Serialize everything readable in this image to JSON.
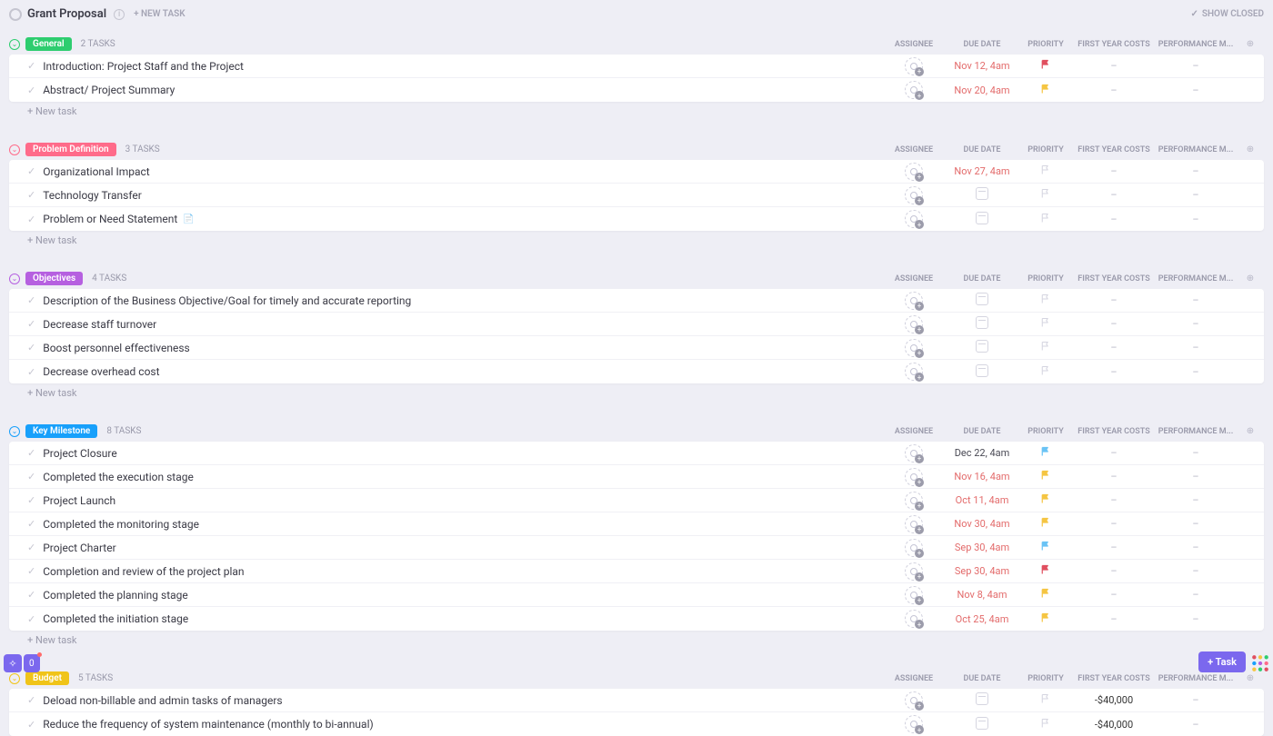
{
  "header": {
    "title": "Grant Proposal",
    "new_task": "+ NEW TASK",
    "show_closed": "SHOW CLOSED"
  },
  "columns": {
    "assignee": "ASSIGNEE",
    "due_date": "DUE DATE",
    "priority": "PRIORITY",
    "first_year": "FIRST YEAR COSTS",
    "perf": "PERFORMANCE M..."
  },
  "colors": {
    "general": "#2ecd6f",
    "problem": "#ff6b8a",
    "objectives": "#b660e0",
    "milestone": "#18a0fb",
    "budget": "#f0c419",
    "flag_red": "#e04f5f",
    "flag_yellow": "#f5c542",
    "flag_blue": "#6ac3f5",
    "flag_grey": "#d5d5e0"
  },
  "add_task": "+ New task",
  "plus": "+",
  "fab": "+  Task",
  "statuses": [
    {
      "name": "General",
      "color_key": "general",
      "count": "2 TASKS",
      "tasks": [
        {
          "name": "Introduction: Project Staff and the Project",
          "due": "Nov 12, 4am",
          "due_red": true,
          "flag": "red",
          "first": "–",
          "perf": "–"
        },
        {
          "name": "Abstract/ Project Summary",
          "due": "Nov 20, 4am",
          "due_red": true,
          "flag": "yellow",
          "first": "–",
          "perf": "–"
        }
      ],
      "show_add": true
    },
    {
      "name": "Problem Definition",
      "color_key": "problem",
      "count": "3 TASKS",
      "tasks": [
        {
          "name": "Organizational Impact",
          "due": "Nov 27, 4am",
          "due_red": true,
          "flag": "grey",
          "first": "–",
          "perf": "–"
        },
        {
          "name": "Technology Transfer",
          "due": "",
          "flag": "grey",
          "first": "–",
          "perf": "–"
        },
        {
          "name": "Problem or Need Statement",
          "doc": true,
          "due": "",
          "flag": "grey",
          "first": "–",
          "perf": "–"
        }
      ],
      "show_add": true
    },
    {
      "name": "Objectives",
      "color_key": "objectives",
      "count": "4 TASKS",
      "tasks": [
        {
          "name": "Description of the Business Objective/Goal for timely and accurate reporting",
          "due": "",
          "flag": "grey",
          "first": "–",
          "perf": "–"
        },
        {
          "name": "Decrease staff turnover",
          "due": "",
          "flag": "grey",
          "first": "–",
          "perf": "–"
        },
        {
          "name": "Boost personnel effectiveness",
          "due": "",
          "flag": "grey",
          "first": "–",
          "perf": "–"
        },
        {
          "name": "Decrease overhead cost",
          "due": "",
          "flag": "grey",
          "first": "–",
          "perf": "–"
        }
      ],
      "show_add": true
    },
    {
      "name": "Key Milestone",
      "color_key": "milestone",
      "count": "8 TASKS",
      "tasks": [
        {
          "name": "Project Closure",
          "due": "Dec 22, 4am",
          "due_red": false,
          "flag": "blue",
          "first": "–",
          "perf": "–"
        },
        {
          "name": "Completed the execution stage",
          "due": "Nov 16, 4am",
          "due_red": true,
          "flag": "yellow",
          "first": "–",
          "perf": "–"
        },
        {
          "name": "Project Launch",
          "due": "Oct 11, 4am",
          "due_red": true,
          "flag": "yellow",
          "first": "–",
          "perf": "–"
        },
        {
          "name": "Completed the monitoring stage",
          "due": "Nov 30, 4am",
          "due_red": true,
          "flag": "yellow",
          "first": "–",
          "perf": "–"
        },
        {
          "name": "Project Charter",
          "due": "Sep 30, 4am",
          "due_red": true,
          "flag": "blue",
          "first": "–",
          "perf": "–"
        },
        {
          "name": "Completion and review of the project plan",
          "due": "Sep 30, 4am",
          "due_red": true,
          "flag": "red",
          "first": "–",
          "perf": "–"
        },
        {
          "name": "Completed the planning stage",
          "due": "Nov 8, 4am",
          "due_red": true,
          "flag": "yellow",
          "first": "–",
          "perf": "–"
        },
        {
          "name": "Completed the initiation stage",
          "due": "Oct 25, 4am",
          "due_red": true,
          "flag": "yellow",
          "first": "–",
          "perf": "–"
        }
      ],
      "show_add": true
    },
    {
      "name": "Budget",
      "color_key": "budget",
      "count": "5 TASKS",
      "tasks": [
        {
          "name": "Deload non-billable and admin tasks of managers",
          "due": "",
          "flag": "grey",
          "first": "-$40,000",
          "perf": "–"
        },
        {
          "name": "Reduce the frequency of system maintenance (monthly to bi-annual)",
          "due": "",
          "flag": "grey",
          "first": "-$40,000",
          "perf": "–"
        }
      ],
      "show_add": false
    }
  ]
}
